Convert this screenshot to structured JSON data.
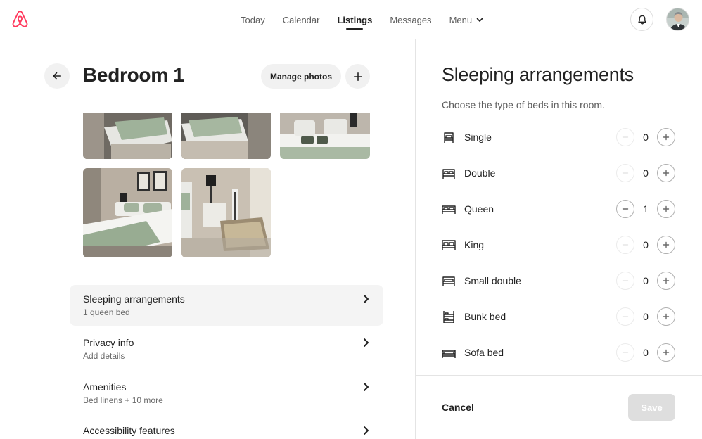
{
  "nav": {
    "items": [
      {
        "label": "Today"
      },
      {
        "label": "Calendar"
      },
      {
        "label": "Listings"
      },
      {
        "label": "Messages"
      }
    ],
    "active_index": 2,
    "menu_label": "Menu"
  },
  "room": {
    "title": "Bedroom 1",
    "manage_photos_label": "Manage photos"
  },
  "sections": [
    {
      "title": "Sleeping arrangements",
      "subtitle": "1 queen bed"
    },
    {
      "title": "Privacy info",
      "subtitle": "Add details"
    },
    {
      "title": "Amenities",
      "subtitle": "Bed linens + 10 more"
    },
    {
      "title": "Accessibility features",
      "subtitle": ""
    }
  ],
  "sleeping": {
    "title": "Sleeping arrangements",
    "subtitle": "Choose the type of beds in this room.",
    "beds": [
      {
        "label": "Single",
        "count": "0"
      },
      {
        "label": "Double",
        "count": "0"
      },
      {
        "label": "Queen",
        "count": "1"
      },
      {
        "label": "King",
        "count": "0"
      },
      {
        "label": "Small double",
        "count": "0"
      },
      {
        "label": "Bunk bed",
        "count": "0"
      },
      {
        "label": "Sofa bed",
        "count": "0"
      }
    ]
  },
  "footer": {
    "cancel_label": "Cancel",
    "save_label": "Save"
  },
  "colors": {
    "brand": "#FF385C",
    "text": "#222222",
    "muted": "#6A6A6A"
  }
}
